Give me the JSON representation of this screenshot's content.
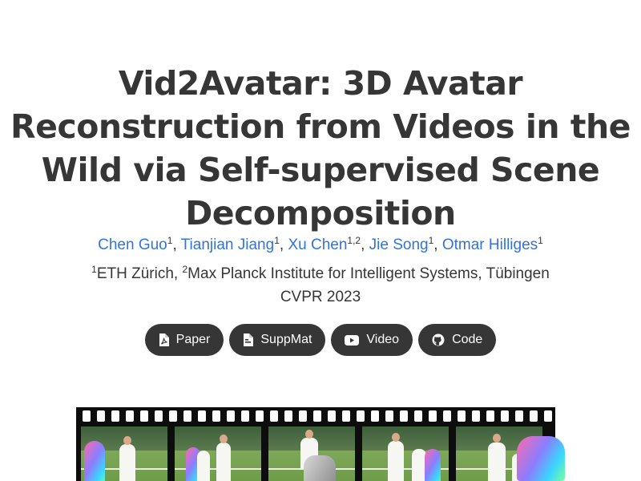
{
  "title": {
    "lines": [
      "Vid2Avatar: 3D Avatar",
      "Reconstruction from Videos in the",
      "Wild via Self-supervised Scene",
      "Decomposition"
    ]
  },
  "authors": [
    {
      "name": "Chen Guo",
      "sup": "1"
    },
    {
      "name": "Tianjian Jiang",
      "sup": "1"
    },
    {
      "name": "Xu Chen",
      "sup": "1,2"
    },
    {
      "name": "Jie Song",
      "sup": "1"
    },
    {
      "name": "Otmar Hilliges",
      "sup": "1"
    }
  ],
  "affiliations": [
    {
      "sup": "1",
      "name": "ETH Zürich"
    },
    {
      "sup": "2",
      "name": "Max Planck Institute for Intelligent Systems, Tübingen"
    }
  ],
  "venue": "CVPR 2023",
  "buttons": [
    {
      "label": "Paper",
      "icon": "pdf-icon"
    },
    {
      "label": "SuppMat",
      "icon": "file-icon"
    },
    {
      "label": "Video",
      "icon": "youtube-icon"
    },
    {
      "label": "Code",
      "icon": "github-icon"
    }
  ],
  "colors": {
    "link": "#3273dc",
    "text": "#363636",
    "button_bg": "#363636"
  }
}
